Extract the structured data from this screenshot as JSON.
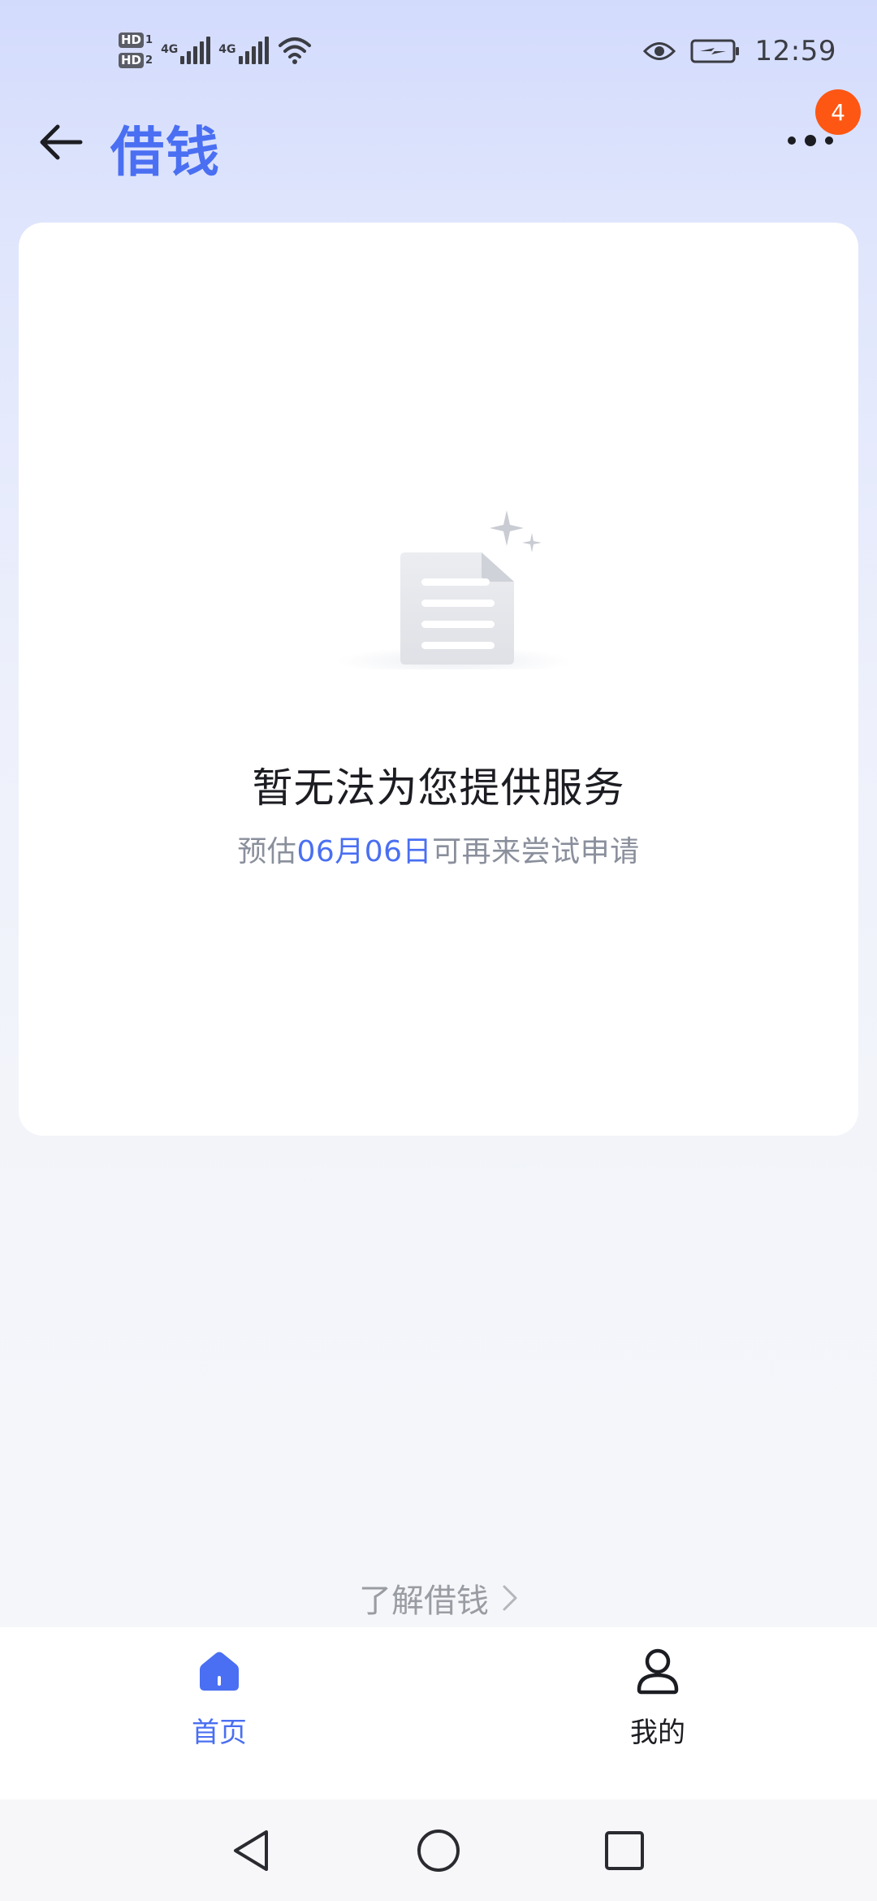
{
  "status_bar": {
    "sim1_label": "HD",
    "sim1_num": "1",
    "sim2_label": "HD",
    "sim2_num": "2",
    "net1": "4G",
    "net2": "4G",
    "time": "12:59"
  },
  "header": {
    "title": "借钱",
    "notification_count": "4"
  },
  "empty_state": {
    "title": "暂无法为您提供服务",
    "subtitle_prefix": "预估",
    "subtitle_date": "06月06日",
    "subtitle_suffix": "可再来尝试申请"
  },
  "learn_link": {
    "label": "了解借钱",
    "arrow": "›"
  },
  "bottom_nav": {
    "items": [
      {
        "label": "首页",
        "icon": "home-icon",
        "active": true
      },
      {
        "label": "我的",
        "icon": "person-icon",
        "active": false
      }
    ]
  },
  "colors": {
    "accent": "#4a6ff2",
    "badge": "#fd5713",
    "text_primary": "#1c1d22",
    "text_secondary": "#8a8f9c"
  },
  "system_nav": {
    "icons": [
      "back-triangle-icon",
      "home-circle-icon",
      "recents-square-icon"
    ]
  }
}
